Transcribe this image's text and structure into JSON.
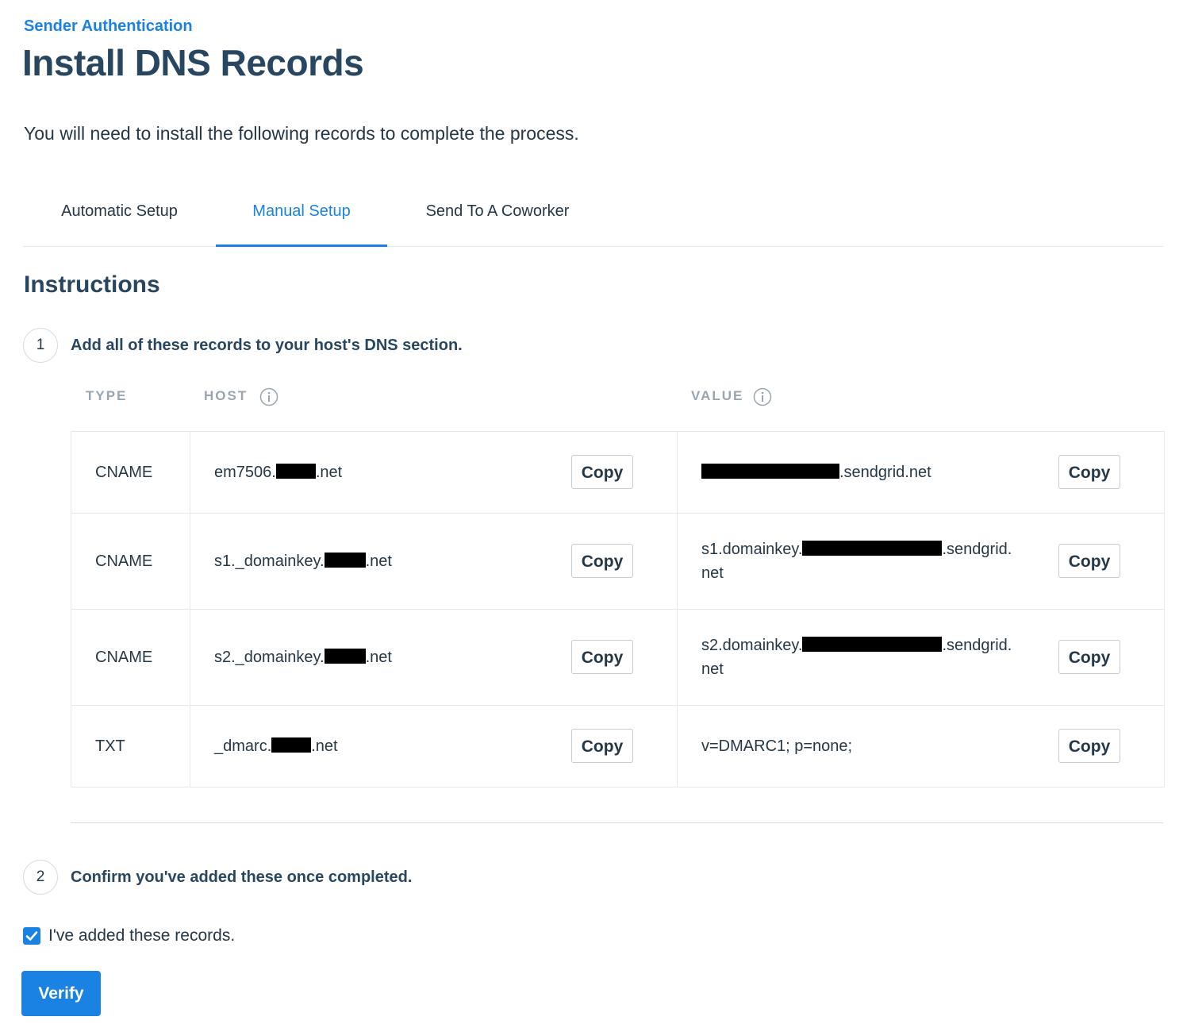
{
  "header": {
    "breadcrumb": "Sender Authentication",
    "title": "Install DNS Records",
    "subtitle": "You will need to install the following records to complete the process."
  },
  "tabs": [
    {
      "label": "Automatic Setup",
      "active": false
    },
    {
      "label": "Manual Setup",
      "active": true
    },
    {
      "label": "Send To A Coworker",
      "active": false
    }
  ],
  "instructions": {
    "title": "Instructions",
    "step1": {
      "number": "1",
      "text": "Add all of these records to your host's DNS section."
    },
    "step2": {
      "number": "2",
      "text": "Confirm you've added these once completed."
    }
  },
  "table": {
    "headers": {
      "type": "TYPE",
      "host": "HOST",
      "value": "VALUE"
    },
    "copy_label": "Copy",
    "rows": [
      {
        "type": "CNAME",
        "host_prefix": "em7506.",
        "host_suffix": ".net",
        "value_prefix": "",
        "value_suffix": ".sendgrid.net",
        "value_tail": ""
      },
      {
        "type": "CNAME",
        "host_prefix": "s1._domainkey.",
        "host_suffix": ".net",
        "value_prefix": "s1.domainkey.",
        "value_suffix": ".sendgrid.",
        "value_tail": "net"
      },
      {
        "type": "CNAME",
        "host_prefix": "s2._domainkey.",
        "host_suffix": ".net",
        "value_prefix": "s2.domainkey.",
        "value_suffix": ".sendgrid.",
        "value_tail": "net"
      },
      {
        "type": "TXT",
        "host_prefix": "_dmarc.",
        "host_suffix": ".net",
        "value_prefix": "v=DMARC1; p=none;",
        "value_suffix": "",
        "value_tail": ""
      }
    ]
  },
  "confirm": {
    "checkbox_label": "I've added these records.",
    "checked": true,
    "verify_label": "Verify"
  },
  "colors": {
    "accent": "#1a82e2",
    "heading": "#294661",
    "text": "#263746",
    "muted": "#9aa5b0",
    "border": "#e6e9ec"
  },
  "icons": {
    "info": "info-circle-icon",
    "check": "checkmark-icon"
  }
}
